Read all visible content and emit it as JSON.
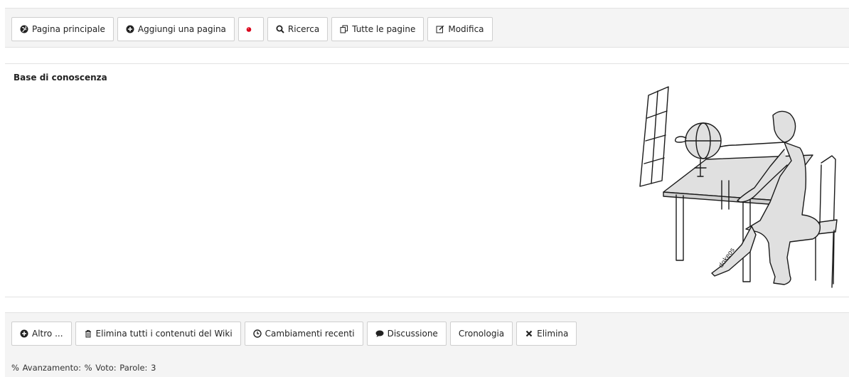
{
  "top_toolbar": {
    "buttons": [
      {
        "label": "Pagina principale",
        "icon": "globe-icon"
      },
      {
        "label": "Aggiungi una pagina",
        "icon": "plus-circle-icon"
      },
      {
        "label": "",
        "icon": "red-dot-icon"
      },
      {
        "label": "Ricerca",
        "icon": "search-icon"
      },
      {
        "label": "Tutte le pagine",
        "icon": "copy-pages-icon"
      },
      {
        "label": "Modifica",
        "icon": "edit-icon"
      }
    ]
  },
  "content": {
    "title": "Base di conoscenza",
    "illustration_signature": "dokeos"
  },
  "bottom_toolbar": {
    "buttons": [
      {
        "label": "Altro ...",
        "icon": "plus-circle-icon"
      },
      {
        "label": "Elimina tutti i contenuti del Wiki",
        "icon": "trash-icon"
      },
      {
        "label": "Cambiamenti recenti",
        "icon": "clock-icon"
      },
      {
        "label": "Discussione",
        "icon": "comment-icon"
      },
      {
        "label": "Cronologia",
        "icon": ""
      },
      {
        "label": "Elimina",
        "icon": "close-icon"
      }
    ],
    "stats": "% Avanzamento: % Voto: Parole: 3"
  },
  "colors": {
    "toolbar_bg": "#f4f4f4",
    "border": "#cfcfcf",
    "dot": "#d9001b"
  }
}
